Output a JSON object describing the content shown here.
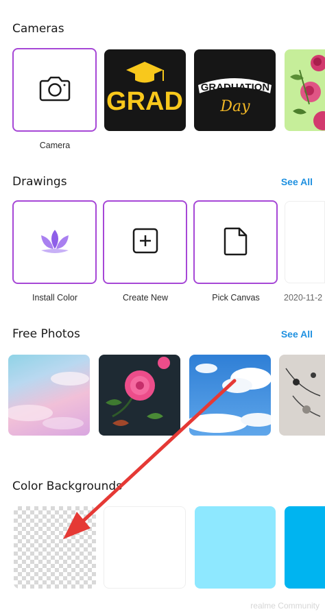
{
  "cameras": {
    "title": "Cameras",
    "items": [
      {
        "label": "Camera",
        "icon": "camera-icon"
      },
      {
        "label": "",
        "art": "GRAD"
      },
      {
        "label": "",
        "art_line1": "GRADUATION",
        "art_line2": "Day"
      },
      {
        "label": ""
      }
    ]
  },
  "drawings": {
    "title": "Drawings",
    "see_all": "See All",
    "items": [
      {
        "label": "Install Color",
        "icon": "lotus-icon"
      },
      {
        "label": "Create New",
        "icon": "plus-square-icon"
      },
      {
        "label": "Pick Canvas",
        "icon": "file-icon"
      },
      {
        "label": "2020-11-2"
      }
    ]
  },
  "free_photos": {
    "title": "Free Photos",
    "see_all": "See All"
  },
  "color_backgrounds": {
    "title": "Color Backgrounds",
    "swatches": [
      "transparent",
      "#ffffff",
      "#8ee8ff",
      "#00b4f0"
    ]
  },
  "colors": {
    "accent_purple": "#a647d6",
    "link_blue": "#1e90e0",
    "arrow_red": "#e53935"
  },
  "watermark": "realme Community"
}
